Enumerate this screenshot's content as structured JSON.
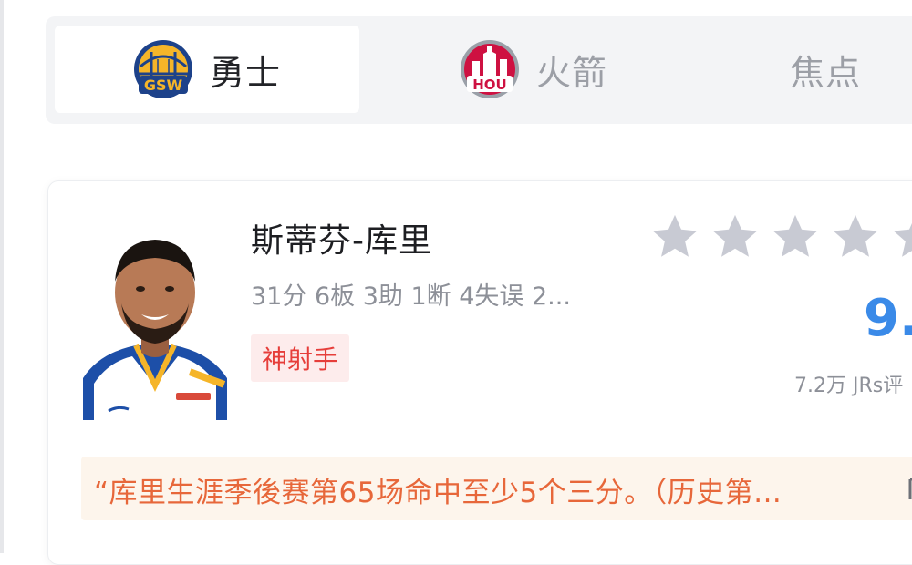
{
  "tabs": [
    {
      "label": "勇士",
      "logo_text": "GSW",
      "active": true
    },
    {
      "label": "火箭",
      "logo_text": "HOU",
      "active": false
    },
    {
      "label": "焦点",
      "active": false
    }
  ],
  "player": {
    "name": "斯蒂芬-库里",
    "stats": "31分 6板 3助 1断 4失误 2...",
    "tag": "神射手",
    "rating": {
      "stars_filled": 5,
      "score": "9.",
      "count": "7.2万 JRs评"
    },
    "quote": "“库里生涯季後赛第65场命中至少5个三分。（历史第..."
  },
  "colors": {
    "accent_blue": "#3a8ae8",
    "tag_red": "#e63e3a",
    "quote_orange": "#e7673a",
    "star_gray": "#c8cad3"
  }
}
